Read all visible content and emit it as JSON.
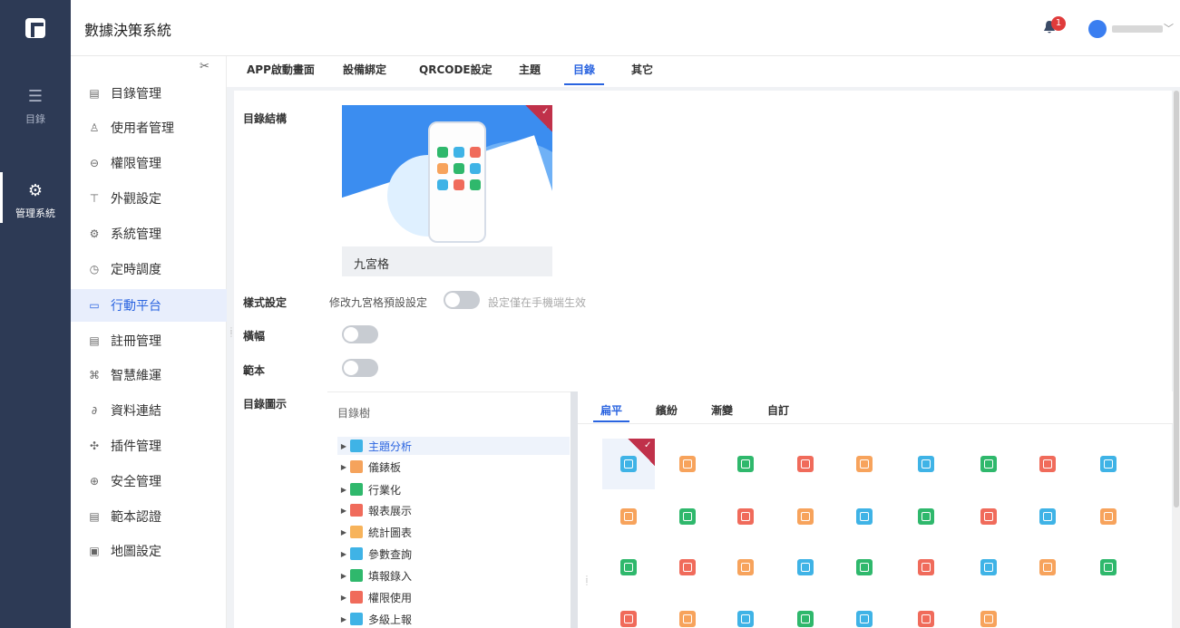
{
  "app": {
    "title": "數據決策系統",
    "notification_count": "1"
  },
  "colors": {
    "accent": "#2a64e0",
    "nav_bg": "#2d3a55",
    "badge": "#e03b3b",
    "check": "#c0314a"
  },
  "iconnav": [
    {
      "label": "目錄",
      "icon": "list-icon"
    },
    {
      "label": "管理系統",
      "icon": "gear-icon"
    }
  ],
  "sidebar": {
    "items": [
      {
        "label": "目錄管理",
        "icon": "catalog-icon"
      },
      {
        "label": "使用者管理",
        "icon": "user-icon"
      },
      {
        "label": "權限管理",
        "icon": "lock-icon"
      },
      {
        "label": "外觀設定",
        "icon": "paint-roller-icon"
      },
      {
        "label": "系統管理",
        "icon": "settings-icon"
      },
      {
        "label": "定時調度",
        "icon": "timer-icon"
      },
      {
        "label": "行動平台",
        "icon": "mobile-icon",
        "active": true
      },
      {
        "label": "註冊管理",
        "icon": "register-icon"
      },
      {
        "label": "智慧維運",
        "icon": "network-icon"
      },
      {
        "label": "資料連結",
        "icon": "link-icon"
      },
      {
        "label": "插件管理",
        "icon": "puzzle-icon"
      },
      {
        "label": "安全管理",
        "icon": "shield-icon"
      },
      {
        "label": "範本認證",
        "icon": "template-icon"
      },
      {
        "label": "地圖設定",
        "icon": "map-icon"
      }
    ]
  },
  "tabs": [
    {
      "label": "APP啟動畫面"
    },
    {
      "label": "設備綁定"
    },
    {
      "label": "QRCODE設定"
    },
    {
      "label": "主題"
    },
    {
      "label": "目錄",
      "active": true
    },
    {
      "label": "其它"
    }
  ],
  "form": {
    "structure_label": "目錄結構",
    "preview_caption": "九宮格",
    "style_label": "樣式設定",
    "style_hint": "修改九宮格預設設定",
    "style_note": "設定僅在手機端生效",
    "banner_label": "橫幅",
    "template_label": "範本",
    "icon_label": "目錄圖示"
  },
  "tree": {
    "title": "目錄樹",
    "items": [
      {
        "label": "主題分析",
        "color": "#3fb3e6",
        "active": true
      },
      {
        "label": "儀錶板",
        "color": "#f5a35c"
      },
      {
        "label": "行業化",
        "color": "#2fb86c"
      },
      {
        "label": "報表展示",
        "color": "#f06b5b"
      },
      {
        "label": "統計圖表",
        "color": "#f7b35b"
      },
      {
        "label": "參數查詢",
        "color": "#3fb3e6"
      },
      {
        "label": "填報錄入",
        "color": "#2fb86c"
      },
      {
        "label": "權限使用",
        "color": "#f06b5b"
      },
      {
        "label": "多級上報",
        "color": "#3fb3e6"
      }
    ]
  },
  "style_tabs": [
    {
      "label": "扁平",
      "active": true
    },
    {
      "label": "繽紛"
    },
    {
      "label": "漸變"
    },
    {
      "label": "自訂"
    }
  ],
  "icon_grid": {
    "rows": [
      [
        "#3fb3e6",
        "#f7a35c",
        "#2fb86c",
        "#f06b5b",
        "#f7a35c",
        "#3fb3e6",
        "#2fb86c",
        "#f06b5b",
        "#3fb3e6"
      ],
      [
        "#f7a35c",
        "#2fb86c",
        "#f06b5b",
        "#f7a35c",
        "#3fb3e6",
        "#2fb86c",
        "#f06b5b",
        "#3fb3e6",
        "#f7a35c"
      ],
      [
        "#2fb86c",
        "#f06b5b",
        "#f7a35c",
        "#3fb3e6",
        "#2fb86c",
        "#f06b5b",
        "#3fb3e6",
        "#f7a35c",
        "#2fb86c"
      ],
      [
        "#f06b5b",
        "#f7a35c",
        "#3fb3e6",
        "#2fb86c",
        "#3fb3e6",
        "#f06b5b",
        "#f7a35c"
      ]
    ]
  }
}
